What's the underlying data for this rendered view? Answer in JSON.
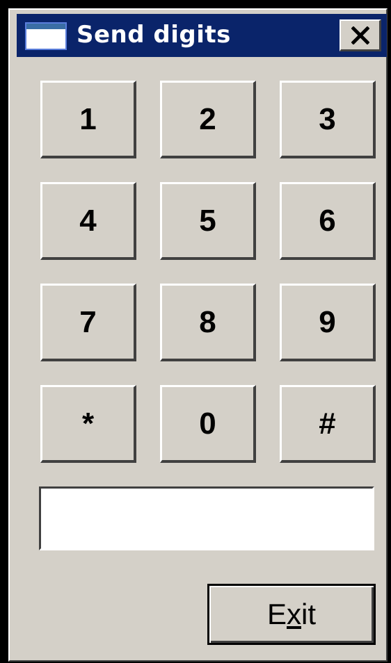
{
  "window": {
    "title": "Send digits",
    "close_glyph": "✕"
  },
  "keypad": {
    "keys": [
      {
        "label": "1"
      },
      {
        "label": "2"
      },
      {
        "label": "3"
      },
      {
        "label": "4"
      },
      {
        "label": "5"
      },
      {
        "label": "6"
      },
      {
        "label": "7"
      },
      {
        "label": "8"
      },
      {
        "label": "9"
      },
      {
        "label": "*"
      },
      {
        "label": "0"
      },
      {
        "label": "#"
      }
    ]
  },
  "digits_field": {
    "value": "",
    "placeholder": ""
  },
  "exit_button": {
    "label_pre": "E",
    "label_mnemonic": "x",
    "label_post": "it"
  },
  "colors": {
    "titlebar": "#0a246a",
    "face": "#d4d0c8",
    "shadow": "#404040",
    "highlight": "#ffffff"
  },
  "icons": {
    "title_icon": "window-icon",
    "close_icon": "close-icon"
  }
}
